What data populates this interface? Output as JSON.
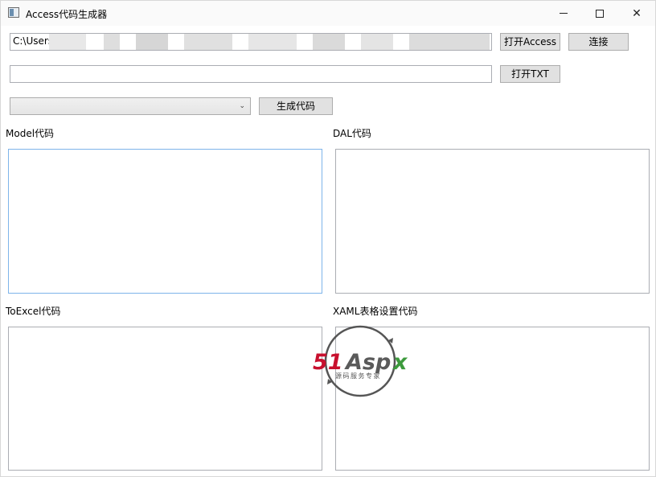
{
  "window": {
    "title": "Access代码生成器",
    "minimize_icon": "minimize-icon",
    "maximize_icon": "maximize-icon",
    "close_icon": "close-icon"
  },
  "access_path": {
    "value": "C:\\Users"
  },
  "txt_path": {
    "value": ""
  },
  "buttons": {
    "open_access": "打开Access",
    "connect": "连接",
    "open_txt": "打开TXT",
    "generate": "生成代码"
  },
  "table_select": {
    "value": ""
  },
  "sections": {
    "model": "Model代码",
    "dal": "DAL代码",
    "toexcel": "ToExcel代码",
    "xaml": "XAML表格设置代码"
  },
  "watermark": {
    "logo": "51Aspx",
    "tagline": "源码服务专家"
  }
}
